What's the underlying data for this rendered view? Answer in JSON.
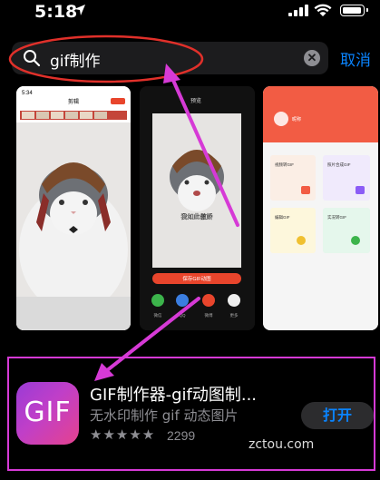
{
  "status": {
    "time": "5:18"
  },
  "search": {
    "query": "gif制作",
    "cancel_label": "取消"
  },
  "screenshots": {
    "shot1": {
      "status_time": "5:34",
      "title": "剪辑"
    },
    "shot2": {
      "title": "预览",
      "caption": "我如此傲娇",
      "action": "保存GIF动图",
      "share": [
        "微信",
        "QQ",
        "微博",
        "更多"
      ]
    },
    "shot3": {
      "user": "昵称",
      "cards": [
        "视频转GIF",
        "照片合成GIF",
        "编辑GIF",
        "实况转GIF"
      ]
    }
  },
  "app": {
    "icon_text": "GIF",
    "name": "GIF制作器-gif动图制...",
    "subtitle": "无水印制作 gif 动态图片",
    "stars": "★★★★★",
    "rating_count": "2299",
    "open_label": "打开"
  },
  "watermark": "zctou.com",
  "colors": {
    "accent": "#0a84ff",
    "annotation_red": "#e0302a",
    "annotation_magenta": "#d63ad6"
  }
}
